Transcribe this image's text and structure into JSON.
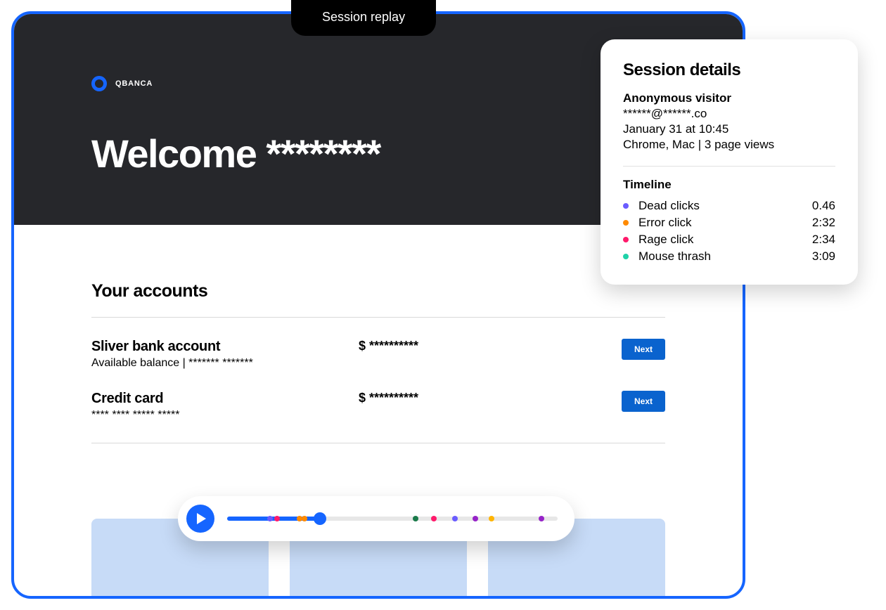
{
  "tab_label": "Session replay",
  "brand": "QBANCA",
  "welcome": "Welcome ********",
  "accounts_heading": "Your accounts",
  "accounts": [
    {
      "name": "Sliver bank account",
      "sub": "Available balance | ******* *******",
      "amount": "$ **********",
      "cta": "Next"
    },
    {
      "name": "Credit card",
      "sub": "**** **** ***** *****",
      "amount": "$ **********",
      "cta": "Next"
    }
  ],
  "details": {
    "title": "Session details",
    "visitor": "Anonymous visitor",
    "email": "******@******.co",
    "datetime": "January 31 at 10:45",
    "env": "Chrome, Mac | 3 page views",
    "timeline_heading": "Timeline",
    "events": [
      {
        "label": "Dead clicks",
        "time": "0.46",
        "color": "#6a5cff"
      },
      {
        "label": "Error click",
        "time": "2:32",
        "color": "#ff8a00"
      },
      {
        "label": "Rage click",
        "time": "2:34",
        "color": "#ff1a6b"
      },
      {
        "label": "Mouse thrash",
        "time": "3:09",
        "color": "#1fd2a8"
      }
    ]
  },
  "player": {
    "progress_pct": 28,
    "markers": [
      {
        "pos": 13,
        "color": "#6a5cff"
      },
      {
        "pos": 15,
        "color": "#ff1a6b"
      },
      {
        "pos": 22,
        "color": "#ff8a00"
      },
      {
        "pos": 23.5,
        "color": "#ff8a00"
      },
      {
        "pos": 57,
        "color": "#1a7a4a"
      },
      {
        "pos": 62.5,
        "color": "#ff1a6b"
      },
      {
        "pos": 69,
        "color": "#6a5cff"
      },
      {
        "pos": 75,
        "color": "#9623c8"
      },
      {
        "pos": 80,
        "color": "#ffb400"
      },
      {
        "pos": 95,
        "color": "#9623c8"
      }
    ]
  }
}
